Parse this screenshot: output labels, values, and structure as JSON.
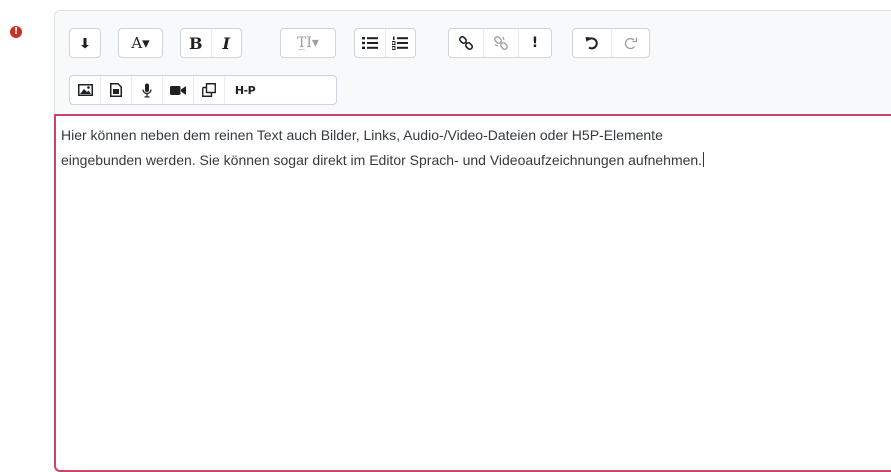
{
  "form": {
    "required_marker": "!"
  },
  "toolbar": {
    "row1": {
      "groups": [
        [
          {
            "name": "show-more-button",
            "icon": "arrow-down-icon",
            "label": "",
            "disabled": false
          }
        ],
        [
          {
            "name": "font-color-button",
            "icon": "font-color-icon",
            "label": "A▾",
            "disabled": false
          }
        ],
        [
          {
            "name": "bold-button",
            "icon": "bold-icon",
            "label": "B",
            "disabled": false
          },
          {
            "name": "italic-button",
            "icon": "italic-icon",
            "label": "I",
            "disabled": false
          }
        ],
        [
          {
            "name": "paragraph-style-button",
            "icon": "paragraph-style-icon",
            "label": "T̲I▾",
            "disabled": true
          }
        ],
        [
          {
            "name": "unordered-list-button",
            "icon": "unordered-list-icon",
            "label": "",
            "disabled": false
          },
          {
            "name": "ordered-list-button",
            "icon": "ordered-list-icon",
            "label": "",
            "disabled": false
          }
        ],
        [
          {
            "name": "link-button",
            "icon": "link-icon",
            "label": "",
            "disabled": false
          },
          {
            "name": "unlink-button",
            "icon": "unlink-icon",
            "label": "",
            "disabled": true
          },
          {
            "name": "accessibility-checker-button",
            "icon": "exclamation-icon",
            "label": "!",
            "disabled": false
          }
        ],
        [
          {
            "name": "undo-button",
            "icon": "undo-icon",
            "label": "",
            "disabled": false
          },
          {
            "name": "redo-button",
            "icon": "redo-icon",
            "label": "",
            "disabled": true
          }
        ]
      ]
    },
    "row2": {
      "groups": [
        [
          {
            "name": "insert-image-button",
            "icon": "image-icon",
            "label": "",
            "disabled": false
          },
          {
            "name": "insert-media-button",
            "icon": "file-media-icon",
            "label": "",
            "disabled": false
          },
          {
            "name": "record-audio-button",
            "icon": "microphone-icon",
            "label": "",
            "disabled": false
          },
          {
            "name": "record-video-button",
            "icon": "video-camera-icon",
            "label": "",
            "disabled": false
          },
          {
            "name": "manage-files-button",
            "icon": "copy-files-icon",
            "label": "",
            "disabled": false
          },
          {
            "name": "insert-h5p-button",
            "icon": "h5p-icon",
            "label": "H-P",
            "disabled": false
          }
        ]
      ]
    }
  },
  "editor": {
    "content_lines": [
      "Hier können neben dem reinen Text auch Bilder, Links, Audio-/Video-Dateien oder H5P-Elemente",
      "eingebunden werden. Sie können sogar direkt im Editor Sprach- und Videoaufzeichnungen aufnehmen."
    ]
  },
  "colors": {
    "required": "#ca3120",
    "focus_border": "#c94465",
    "toolbar_bg": "#f8f9fa"
  }
}
